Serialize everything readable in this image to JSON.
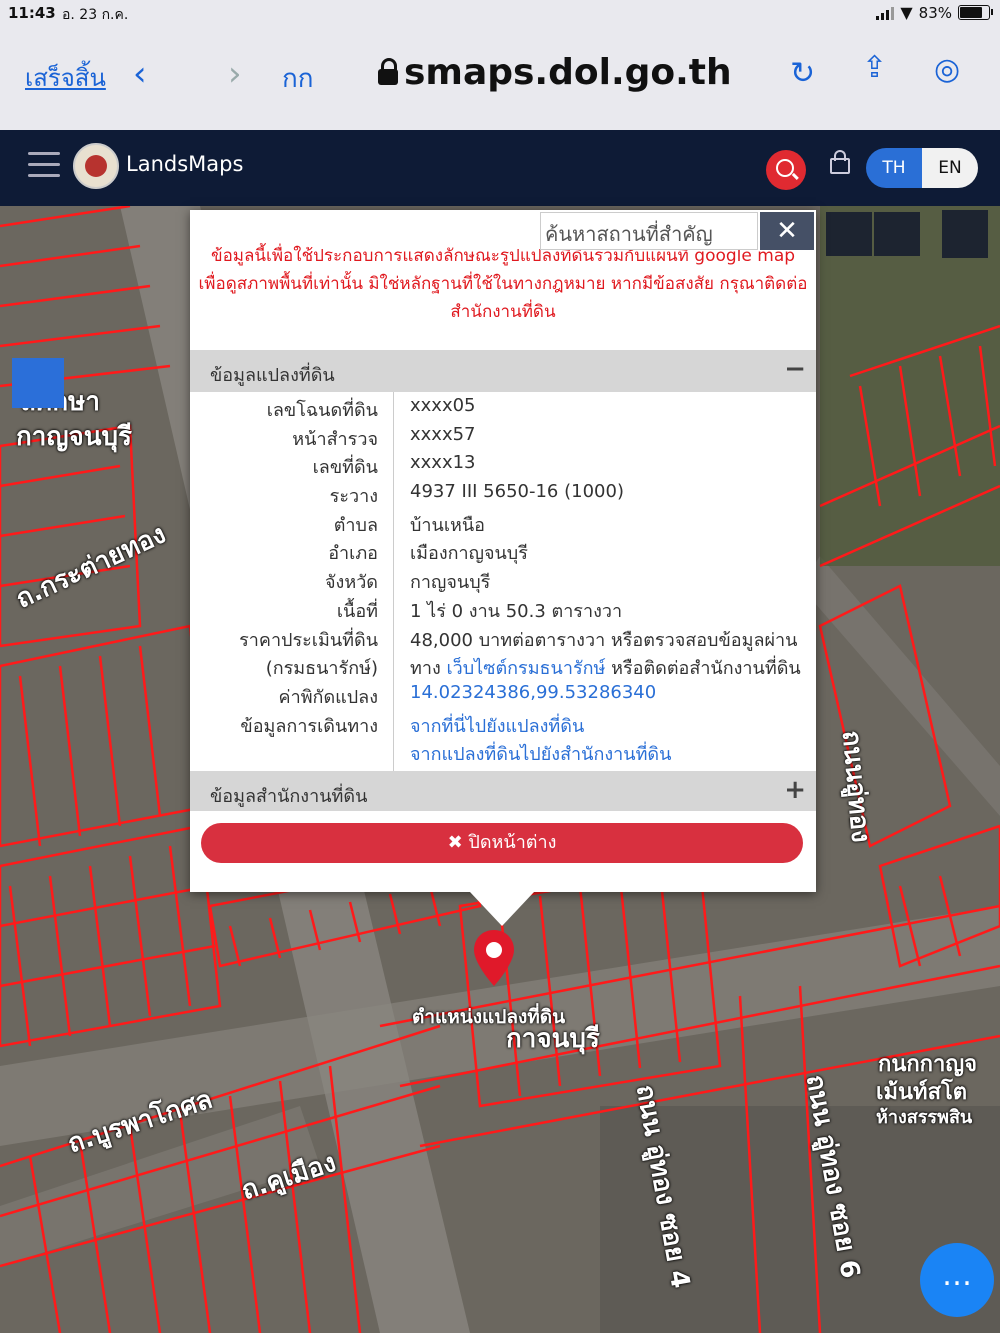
{
  "status_bar": {
    "time": "11:43",
    "date": "อ. 23 ก.ค.",
    "battery": "83%",
    "battery_level": 0.83
  },
  "browser": {
    "done_label": "เสร็จสิ้น",
    "text_size_label": "กก",
    "url": "smaps.dol.go.th"
  },
  "app": {
    "brand": "LandsMaps",
    "lang_th": "TH",
    "lang_en": "EN"
  },
  "map_search": {
    "placeholder": "ค้นหาสถานที่สำคัญ"
  },
  "popup": {
    "disclaimer": [
      "ข้อมูลนี้เพื่อใช้ประกอบการแสดงลักษณะรูปแปลงที่ดินร่วมกับแผนที่ google map",
      "เพื่อดูสภาพพื้นที่เท่านั้น มิใช่หลักฐานที่ใช้ในทางกฎหมาย หากมีข้อสงสัย กรุณาติดต่อ",
      "สำนักงานที่ดิน"
    ],
    "section_parcel": "ข้อมูลแปลงที่ดิน",
    "section_office": "ข้อมูลสำนักงานที่ดิน",
    "fields": {
      "deed_no_label": "เลขโฉนดที่ดิน",
      "deed_no": "xxxx05",
      "survey_label": "หน้าสำรวจ",
      "survey": "xxxx57",
      "land_no_label": "เลขที่ดิน",
      "land_no": "xxxx13",
      "sheet_label": "ระวาง",
      "sheet": "4937 III 5650-16 (1000)",
      "subdistrict_label": "ตำบล",
      "subdistrict": "บ้านเหนือ",
      "district_label": "อำเภอ",
      "district": "เมืองกาญจนบุรี",
      "province_label": "จังหวัด",
      "province": "กาญจนบุรี",
      "area_label": "เนื้อที่",
      "area": "1 ไร่ 0 งาน 50.3 ตารางวา",
      "price_label": "ราคาประเมินที่ดิน",
      "price": "48,000 บาทต่อตารางวา หรือตรวจสอบข้อมูลผ่าน",
      "price_label2": "(กรมธนารักษ์)",
      "price_prefix": "ทาง ",
      "price_link": "เว็บไซต์กรมธนารักษ์",
      "price_suffix": " หรือติดต่อสำนักงานที่ดิน",
      "coord_label": "ค่าพิกัดแปลง",
      "coord": "14.02324386,99.53286340",
      "travel_label": "ข้อมูลการเดินทาง",
      "travel_to": "จากที่นี่ไปยังแปลงที่ดิน",
      "travel_office": "จากแปลงที่ดินไปยังสำนักงานที่ดิน"
    },
    "close_label": "ปิดหน้าต่าง"
  },
  "map_labels": {
    "school": "ลศึกษา",
    "school2": "กาญจนบุรี",
    "road1": "ถ.กระต่ายทอง",
    "marker": "ตำแหน่งแปลงที่ดิน",
    "place": "กาจนบุรี",
    "road2": "ถ.บูรพาโกศล",
    "road3": "ถ.คูเมือง",
    "road4": "ถนน อู่ทอง ซอย 4",
    "road5": "ถนน อู่ทอง ซอย 6",
    "road6": "ถนนอู่ทอง",
    "shop1": "กนกกาญจ",
    "shop2": "เม้นท์สโต",
    "shop3": "ห้างสรรพสิน"
  },
  "colors": {
    "parcel": "#ff1a1a",
    "header": "#0e1b36",
    "accent": "#e02a31",
    "link": "#2a6fd6"
  }
}
